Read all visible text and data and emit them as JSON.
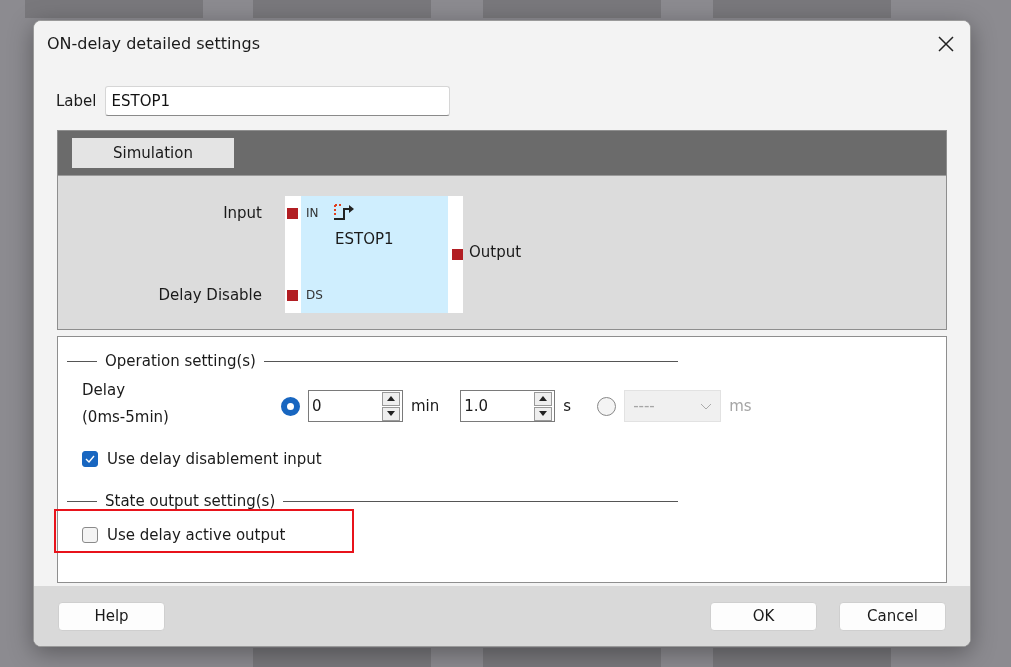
{
  "window": {
    "title": "ON-delay detailed settings"
  },
  "label_field": {
    "label": "Label",
    "value": "ESTOP1"
  },
  "simulation_button": {
    "label": "Simulation"
  },
  "block": {
    "name": "ESTOP1",
    "inputs": [
      {
        "label": "Input",
        "pin": "IN"
      },
      {
        "label": "Delay Disable",
        "pin": "DS"
      }
    ],
    "output": "Output"
  },
  "operation": {
    "title": "Operation setting(s)",
    "delay_label": "Delay",
    "delay_range": "(0ms-5min)",
    "modes": [
      {
        "kind": "spinners",
        "selected": true,
        "fields": [
          {
            "value": "0",
            "unit": "min"
          },
          {
            "value": "1.0",
            "unit": "s"
          }
        ]
      },
      {
        "kind": "dropdown",
        "selected": false,
        "disabled": true,
        "value": "----",
        "unit": "ms"
      }
    ],
    "options": [
      {
        "label": "Use delay disablement input",
        "checked": true
      }
    ]
  },
  "state_output": {
    "title": "State output setting(s)",
    "options": [
      {
        "label": "Use delay active output",
        "checked": false,
        "highlighted": true
      }
    ]
  },
  "buttons": [
    {
      "label": "Help"
    },
    {
      "label": "OK"
    },
    {
      "label": "Cancel"
    }
  ]
}
